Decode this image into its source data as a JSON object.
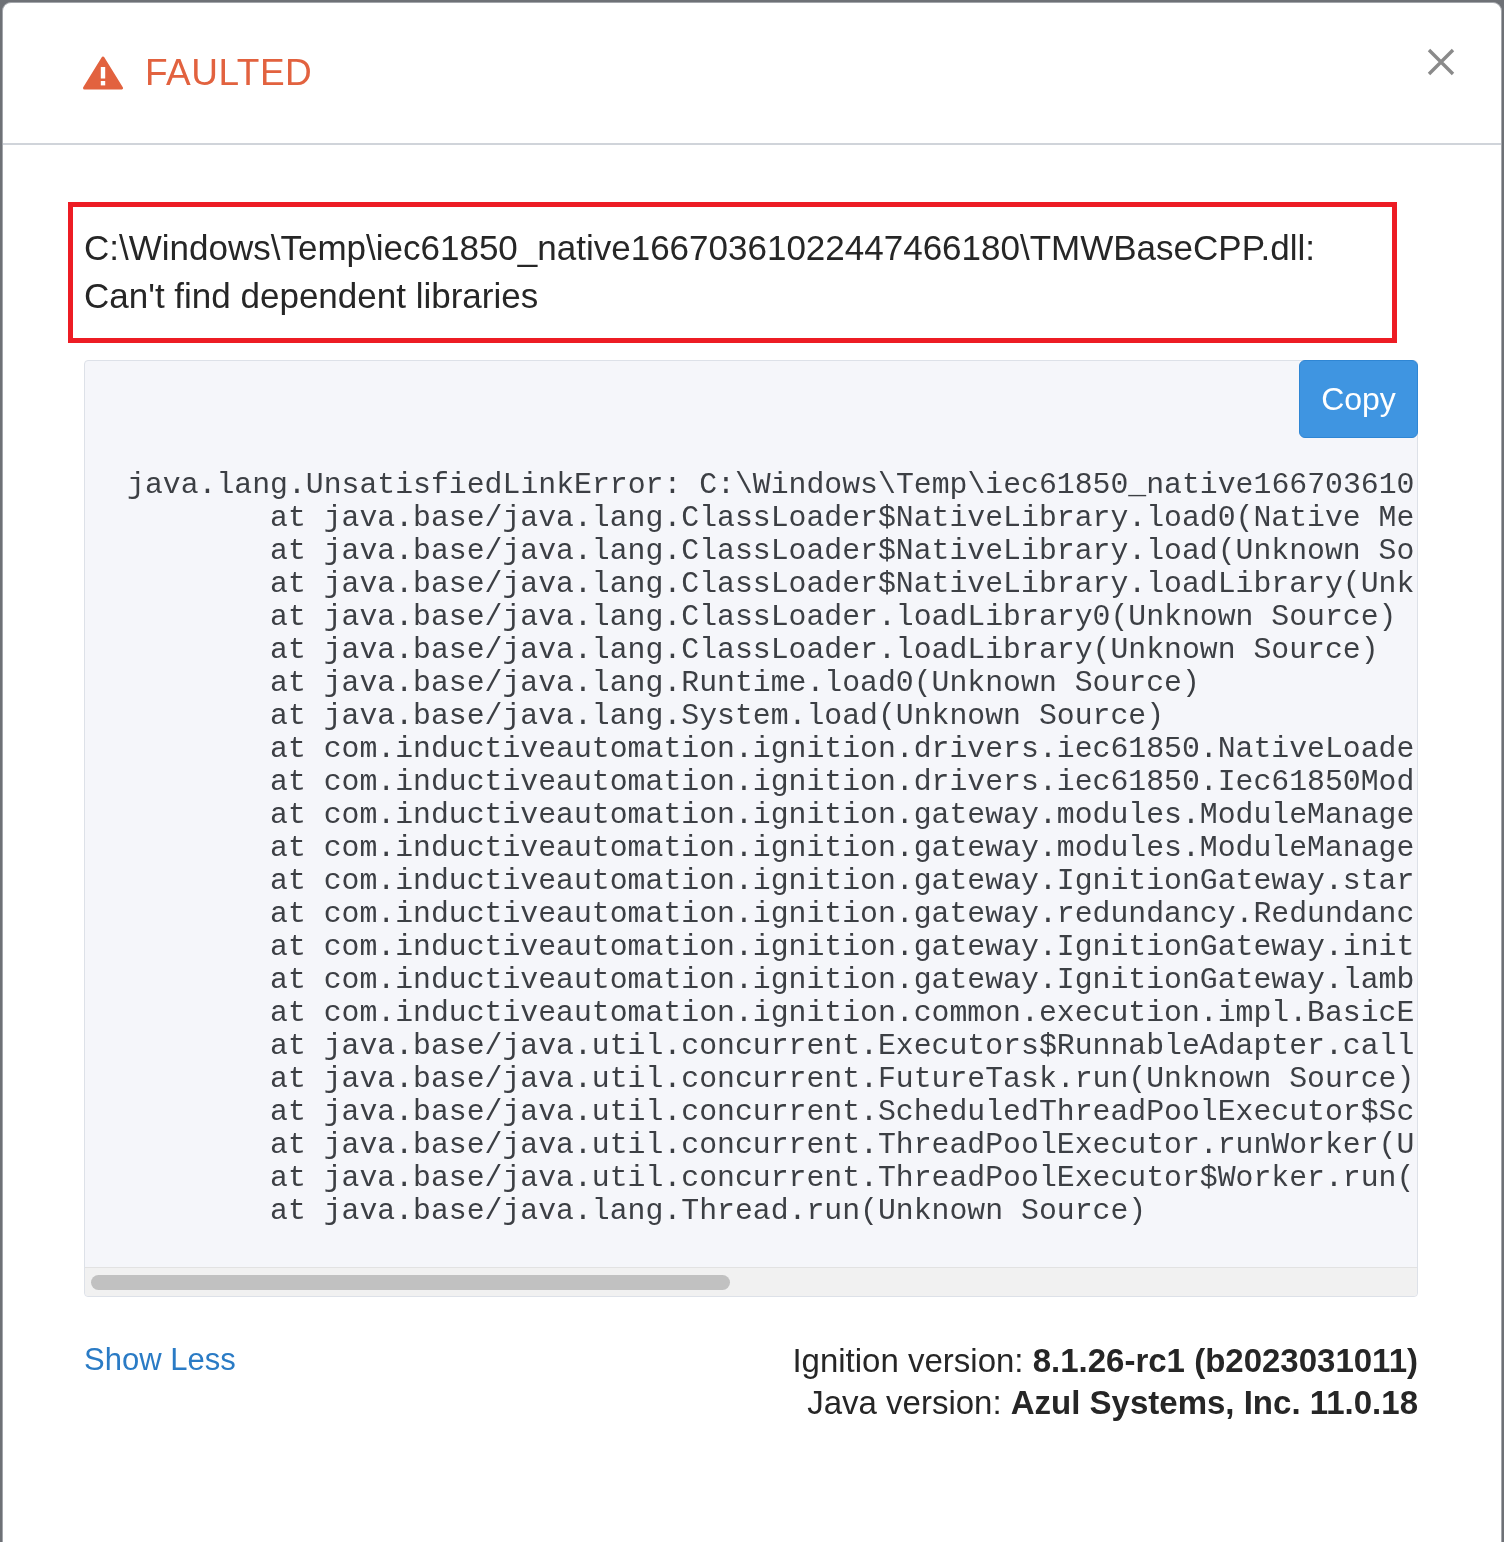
{
  "header": {
    "status": "FAULTED"
  },
  "error_message": "C:\\Windows\\Temp\\iec61850_native16670361022447466180\\TMWBaseCPP.dll: Can't find dependent libraries",
  "stack_trace": {
    "copy_button": "Copy",
    "exception": "java.lang.UnsatisfiedLinkError: C:\\Windows\\Temp\\iec61850_native166703610",
    "frames": [
      "at java.base/java.lang.ClassLoader$NativeLibrary.load0(Native Me",
      "at java.base/java.lang.ClassLoader$NativeLibrary.load(Unknown So",
      "at java.base/java.lang.ClassLoader$NativeLibrary.loadLibrary(Unk",
      "at java.base/java.lang.ClassLoader.loadLibrary0(Unknown Source)",
      "at java.base/java.lang.ClassLoader.loadLibrary(Unknown Source)",
      "at java.base/java.lang.Runtime.load0(Unknown Source)",
      "at java.base/java.lang.System.load(Unknown Source)",
      "at com.inductiveautomation.ignition.drivers.iec61850.NativeLoade",
      "at com.inductiveautomation.ignition.drivers.iec61850.Iec61850Mod",
      "at com.inductiveautomation.ignition.gateway.modules.ModuleManage",
      "at com.inductiveautomation.ignition.gateway.modules.ModuleManage",
      "at com.inductiveautomation.ignition.gateway.IgnitionGateway.star",
      "at com.inductiveautomation.ignition.gateway.redundancy.Redundanc",
      "at com.inductiveautomation.ignition.gateway.IgnitionGateway.init",
      "at com.inductiveautomation.ignition.gateway.IgnitionGateway.lamb",
      "at com.inductiveautomation.ignition.common.execution.impl.BasicE",
      "at java.base/java.util.concurrent.Executors$RunnableAdapter.call",
      "at java.base/java.util.concurrent.FutureTask.run(Unknown Source)",
      "at java.base/java.util.concurrent.ScheduledThreadPoolExecutor$Sc",
      "at java.base/java.util.concurrent.ThreadPoolExecutor.runWorker(U",
      "at java.base/java.util.concurrent.ThreadPoolExecutor$Worker.run(",
      "at java.base/java.lang.Thread.run(Unknown Source)"
    ]
  },
  "footer": {
    "toggle_link": "Show Less",
    "versions": [
      "Ignition version: **8.1.26-rc1 (b2023031011)**",
      "Java version: **Azul Systems, Inc. 11.0.18**"
    ]
  }
}
